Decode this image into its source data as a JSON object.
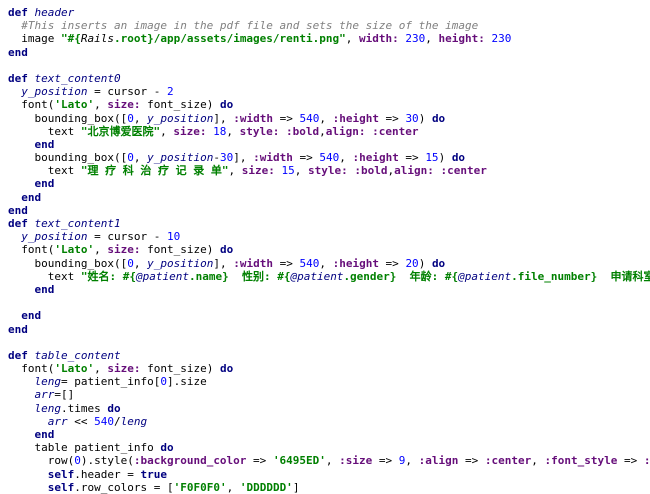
{
  "editor": {
    "language": "ruby",
    "colors": {
      "keyword": "#000080",
      "string": "#008000",
      "symbol": "#660e7a",
      "number": "#0000ff",
      "comment": "#808080"
    },
    "lines": [
      [
        [
          "kw",
          "def"
        ],
        [
          "p",
          " "
        ],
        [
          "name",
          "header"
        ]
      ],
      [
        [
          "p",
          "  "
        ],
        [
          "comment",
          "#This inserts an image in the pdf file and sets the size of the image"
        ]
      ],
      [
        [
          "p",
          "  image "
        ],
        [
          "str",
          "\"#{"
        ],
        [
          "const",
          "Rails"
        ],
        [
          "str",
          ".root}/app/assets/images/renti.png\""
        ],
        [
          "p",
          ", "
        ],
        [
          "sym",
          "width:"
        ],
        [
          "p",
          " "
        ],
        [
          "num",
          "230"
        ],
        [
          "p",
          ", "
        ],
        [
          "sym",
          "height:"
        ],
        [
          "p",
          " "
        ],
        [
          "num",
          "230"
        ]
      ],
      [
        [
          "kw",
          "end"
        ]
      ],
      [
        [
          "p",
          ""
        ]
      ],
      [
        [
          "kw",
          "def"
        ],
        [
          "p",
          " "
        ],
        [
          "name",
          "text_content0"
        ]
      ],
      [
        [
          "p",
          "  "
        ],
        [
          "ivar",
          "y_position"
        ],
        [
          "p",
          " = cursor - "
        ],
        [
          "num",
          "2"
        ]
      ],
      [
        [
          "p",
          "  font("
        ],
        [
          "str",
          "'Lato'"
        ],
        [
          "p",
          ", "
        ],
        [
          "sym",
          "size:"
        ],
        [
          "p",
          " font_size) "
        ],
        [
          "kw",
          "do"
        ]
      ],
      [
        [
          "p",
          "    bounding_box(["
        ],
        [
          "num",
          "0"
        ],
        [
          "p",
          ", "
        ],
        [
          "ivar",
          "y_position"
        ],
        [
          "p",
          "], "
        ],
        [
          "sym",
          ":width"
        ],
        [
          "p",
          " => "
        ],
        [
          "num",
          "540"
        ],
        [
          "p",
          ", "
        ],
        [
          "sym",
          ":height"
        ],
        [
          "p",
          " => "
        ],
        [
          "num",
          "30"
        ],
        [
          "p",
          ") "
        ],
        [
          "kw",
          "do"
        ]
      ],
      [
        [
          "p",
          "      text "
        ],
        [
          "str",
          "\"北京博爱医院\""
        ],
        [
          "p",
          ", "
        ],
        [
          "sym",
          "size:"
        ],
        [
          "p",
          " "
        ],
        [
          "num",
          "18"
        ],
        [
          "p",
          ", "
        ],
        [
          "sym",
          "style:"
        ],
        [
          "p",
          " "
        ],
        [
          "sym",
          ":bold"
        ],
        [
          "p",
          ","
        ],
        [
          "sym",
          "align:"
        ],
        [
          "p",
          " "
        ],
        [
          "sym",
          ":center"
        ]
      ],
      [
        [
          "p",
          "    "
        ],
        [
          "kw",
          "end"
        ]
      ],
      [
        [
          "p",
          "    bounding_box(["
        ],
        [
          "num",
          "0"
        ],
        [
          "p",
          ", "
        ],
        [
          "ivar",
          "y_position"
        ],
        [
          "p",
          "-"
        ],
        [
          "num",
          "30"
        ],
        [
          "p",
          "], "
        ],
        [
          "sym",
          ":width"
        ],
        [
          "p",
          " => "
        ],
        [
          "num",
          "540"
        ],
        [
          "p",
          ", "
        ],
        [
          "sym",
          ":height"
        ],
        [
          "p",
          " => "
        ],
        [
          "num",
          "15"
        ],
        [
          "p",
          ") "
        ],
        [
          "kw",
          "do"
        ]
      ],
      [
        [
          "p",
          "      text "
        ],
        [
          "str",
          "\"理 疗 科 治 疗 记 录 单\""
        ],
        [
          "p",
          ", "
        ],
        [
          "sym",
          "size:"
        ],
        [
          "p",
          " "
        ],
        [
          "num",
          "15"
        ],
        [
          "p",
          ", "
        ],
        [
          "sym",
          "style:"
        ],
        [
          "p",
          " "
        ],
        [
          "sym",
          ":bold"
        ],
        [
          "p",
          ","
        ],
        [
          "sym",
          "align:"
        ],
        [
          "p",
          " "
        ],
        [
          "sym",
          ":center"
        ]
      ],
      [
        [
          "p",
          "    "
        ],
        [
          "kw",
          "end"
        ]
      ],
      [
        [
          "p",
          "  "
        ],
        [
          "kw",
          "end"
        ]
      ],
      [
        [
          "kw",
          "end"
        ]
      ],
      [
        [
          "kw",
          "def"
        ],
        [
          "p",
          " "
        ],
        [
          "name",
          "text_content1"
        ]
      ],
      [
        [
          "p",
          "  "
        ],
        [
          "ivar",
          "y_position"
        ],
        [
          "p",
          " = cursor - "
        ],
        [
          "num",
          "10"
        ]
      ],
      [
        [
          "p",
          "  font("
        ],
        [
          "str",
          "'Lato'"
        ],
        [
          "p",
          ", "
        ],
        [
          "sym",
          "size:"
        ],
        [
          "p",
          " font_size) "
        ],
        [
          "kw",
          "do"
        ]
      ],
      [
        [
          "p",
          "    bounding_box(["
        ],
        [
          "num",
          "0"
        ],
        [
          "p",
          ", "
        ],
        [
          "ivar",
          "y_position"
        ],
        [
          "p",
          "], "
        ],
        [
          "sym",
          ":width"
        ],
        [
          "p",
          " => "
        ],
        [
          "num",
          "540"
        ],
        [
          "p",
          ", "
        ],
        [
          "sym",
          ":height"
        ],
        [
          "p",
          " => "
        ],
        [
          "num",
          "20"
        ],
        [
          "p",
          ") "
        ],
        [
          "kw",
          "do"
        ]
      ],
      [
        [
          "p",
          "      text "
        ],
        [
          "str",
          "\"姓名: #{"
        ],
        [
          "ivar",
          "@patient"
        ],
        [
          "str",
          ".name}  性别: #{"
        ],
        [
          "ivar",
          "@patient"
        ],
        [
          "str",
          ".gender}  年龄: #{"
        ],
        [
          "ivar",
          "@patient"
        ],
        [
          "str",
          ".file_number}  申请科室: #{"
        ],
        [
          "ivar",
          "@pati"
        ]
      ],
      [
        [
          "p",
          "    "
        ],
        [
          "kw",
          "end"
        ]
      ],
      [
        [
          "p",
          ""
        ]
      ],
      [
        [
          "p",
          "  "
        ],
        [
          "kw",
          "end"
        ]
      ],
      [
        [
          "kw",
          "end"
        ]
      ],
      [
        [
          "p",
          ""
        ]
      ],
      [
        [
          "kw",
          "def"
        ],
        [
          "p",
          " "
        ],
        [
          "name",
          "table_content"
        ]
      ],
      [
        [
          "p",
          "  font("
        ],
        [
          "str",
          "'Lato'"
        ],
        [
          "p",
          ", "
        ],
        [
          "sym",
          "size:"
        ],
        [
          "p",
          " font_size) "
        ],
        [
          "kw",
          "do"
        ]
      ],
      [
        [
          "p",
          "    "
        ],
        [
          "ivar",
          "leng"
        ],
        [
          "p",
          "= patient_info["
        ],
        [
          "num",
          "0"
        ],
        [
          "p",
          "].size"
        ]
      ],
      [
        [
          "p",
          "    "
        ],
        [
          "ivar",
          "arr"
        ],
        [
          "p",
          "=[]"
        ]
      ],
      [
        [
          "p",
          "    "
        ],
        [
          "ivar",
          "leng"
        ],
        [
          "p",
          ".times "
        ],
        [
          "kw",
          "do"
        ]
      ],
      [
        [
          "p",
          "      "
        ],
        [
          "ivar",
          "arr"
        ],
        [
          "p",
          " << "
        ],
        [
          "num",
          "540"
        ],
        [
          "p",
          "/"
        ],
        [
          "ivar",
          "leng"
        ]
      ],
      [
        [
          "p",
          "    "
        ],
        [
          "kw",
          "end"
        ]
      ],
      [
        [
          "p",
          "    table patient_info "
        ],
        [
          "kw",
          "do"
        ]
      ],
      [
        [
          "p",
          "      row("
        ],
        [
          "num",
          "0"
        ],
        [
          "p",
          ").style("
        ],
        [
          "sym",
          ":background_color"
        ],
        [
          "p",
          " => "
        ],
        [
          "str",
          "'6495ED'"
        ],
        [
          "p",
          ", "
        ],
        [
          "sym",
          ":size"
        ],
        [
          "p",
          " => "
        ],
        [
          "num",
          "9"
        ],
        [
          "p",
          ", "
        ],
        [
          "sym",
          ":align"
        ],
        [
          "p",
          " => "
        ],
        [
          "sym",
          ":center"
        ],
        [
          "p",
          ", "
        ],
        [
          "sym",
          ":font_style"
        ],
        [
          "p",
          " => "
        ],
        [
          "sym",
          ":bold"
        ],
        [
          "p",
          ")"
        ]
      ],
      [
        [
          "p",
          "      "
        ],
        [
          "kw",
          "self"
        ],
        [
          "p",
          ".header = "
        ],
        [
          "kw",
          "true"
        ]
      ],
      [
        [
          "p",
          "      "
        ],
        [
          "kw",
          "self"
        ],
        [
          "p",
          ".row_colors = ["
        ],
        [
          "str",
          "'F0F0F0'"
        ],
        [
          "p",
          ", "
        ],
        [
          "str",
          "'DDDDDD'"
        ],
        [
          "p",
          "]"
        ]
      ]
    ]
  }
}
